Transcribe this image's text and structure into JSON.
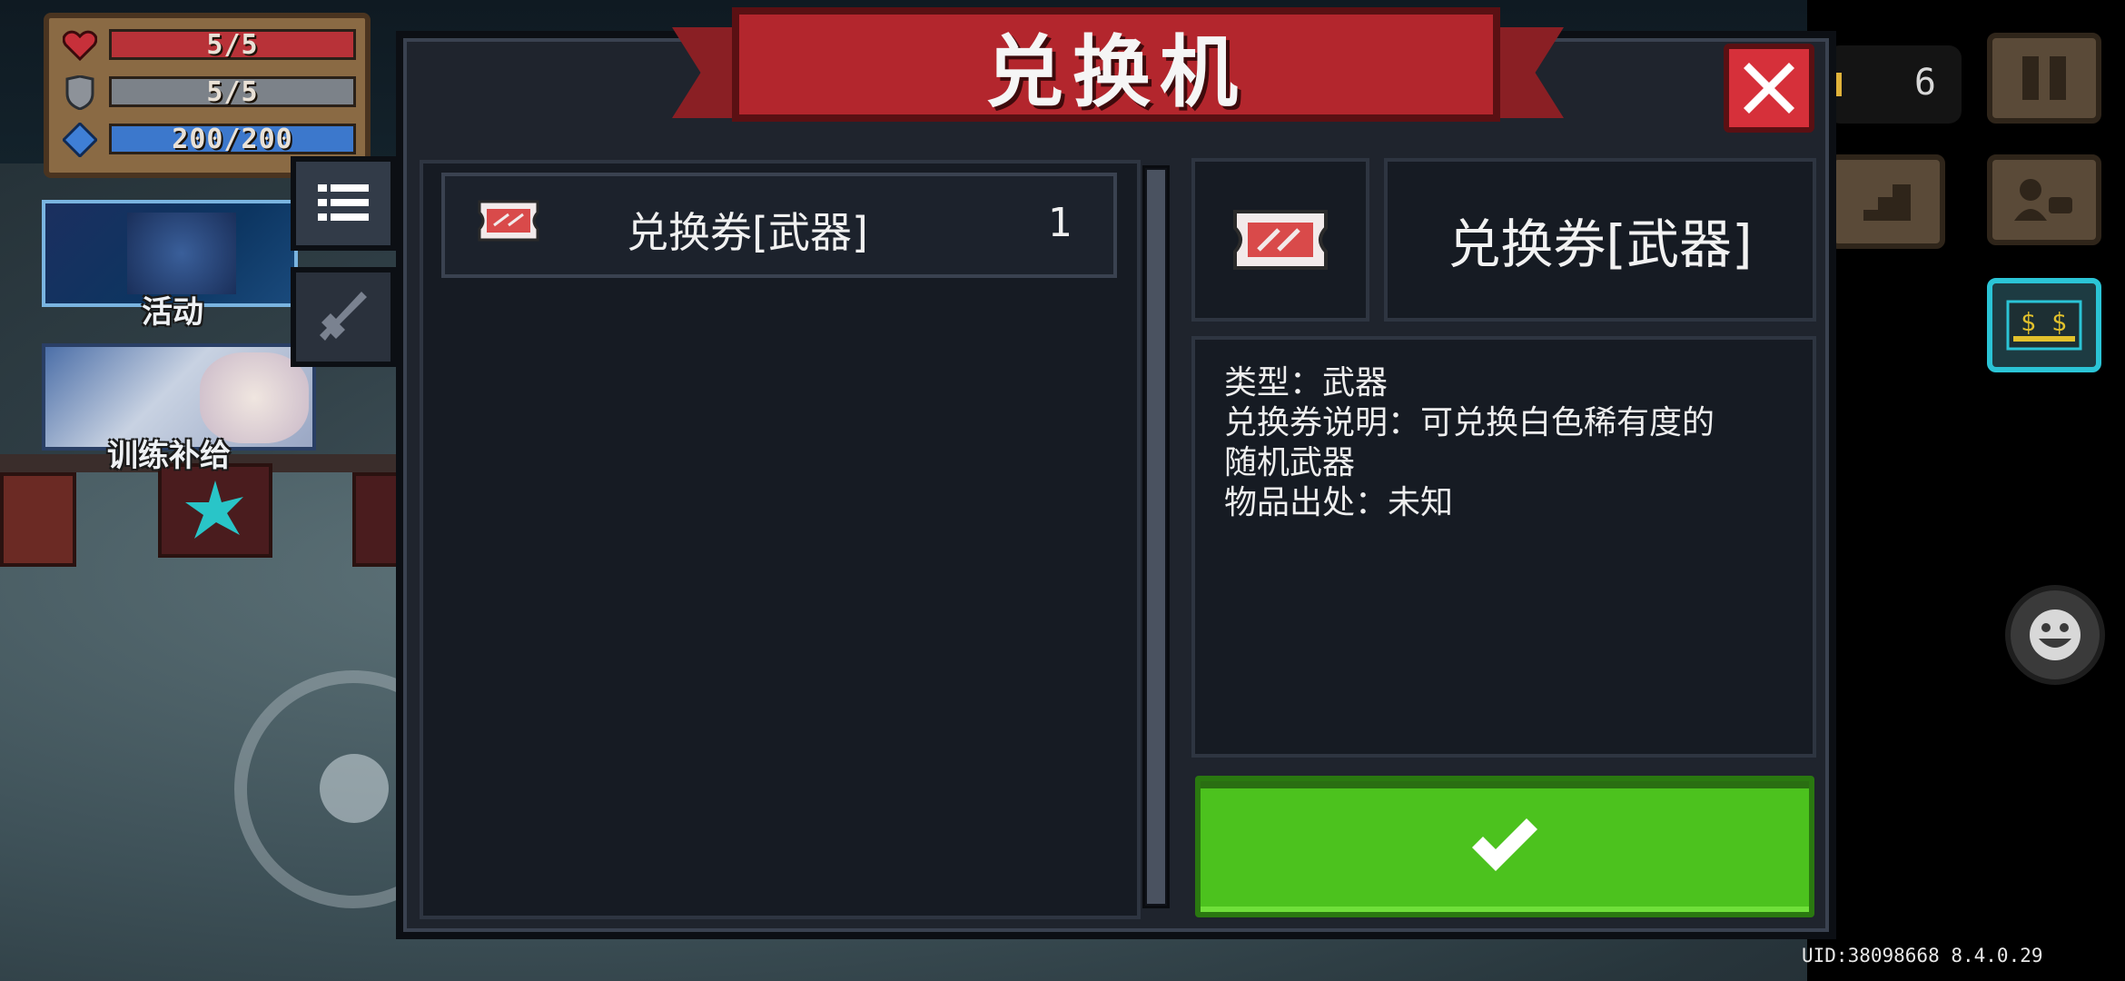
{
  "hud": {
    "health": "5/5",
    "armor": "5/5",
    "energy": "200/200",
    "health_fraction": 1.0,
    "armor_fraction": 1.0,
    "energy_fraction": 1.0,
    "coins": "6",
    "uid": "UID:38098668 8.4.0.29"
  },
  "promos": {
    "event_label": "活动",
    "supply_label": "训练补给"
  },
  "modal": {
    "title": "兑换机",
    "list_items": [
      {
        "name": "兑换券[武器]",
        "count": "1",
        "icon": "ticket-icon"
      }
    ],
    "detail": {
      "name": "兑换券[武器]",
      "lines": [
        "类型：武器",
        "兑换券说明：可兑换白色稀有度的",
        "随机武器",
        "物品出处：未知"
      ]
    }
  },
  "colors": {
    "banner_red": "#b3262d",
    "confirm_green": "#4cc21e",
    "close_red": "#d6303a",
    "panel_bg": "#161b23"
  }
}
